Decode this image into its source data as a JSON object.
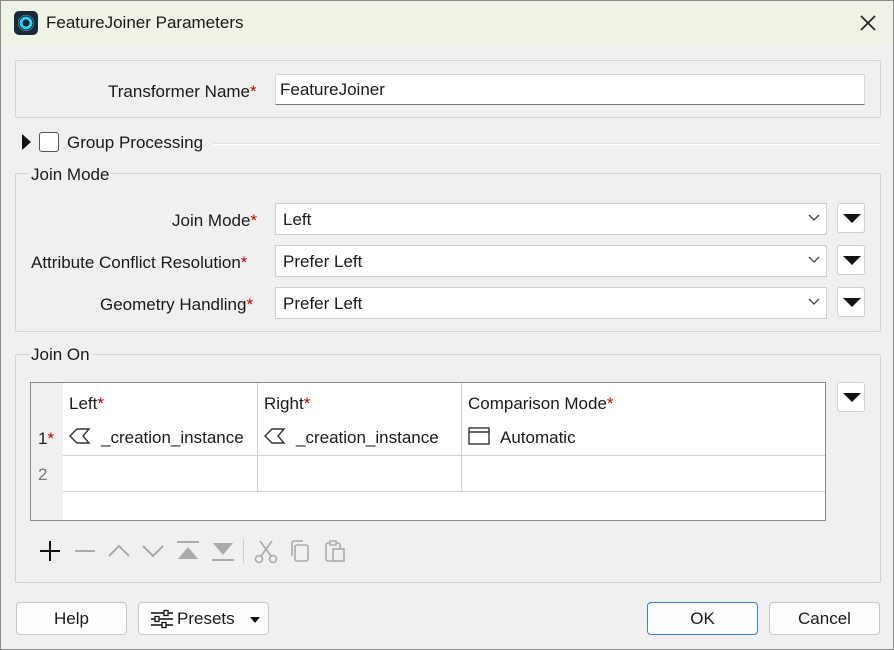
{
  "window": {
    "title": "FeatureJoiner Parameters",
    "close_glyph": "✕"
  },
  "transformer": {
    "label": "Transformer Name",
    "value": "FeatureJoiner"
  },
  "group_processing": {
    "label": "Group Processing",
    "checked": false
  },
  "join_mode_group": {
    "title": "Join Mode",
    "fields": [
      {
        "label": "Join Mode",
        "value": "Left"
      },
      {
        "label": "Attribute Conflict Resolution",
        "value": "Prefer Left"
      },
      {
        "label": "Geometry Handling",
        "value": "Prefer Left"
      }
    ]
  },
  "join_on_group": {
    "title": "Join On",
    "columns": [
      "Left",
      "Right",
      "Comparison Mode"
    ],
    "rows": [
      {
        "num": "1",
        "required": true,
        "left": "_creation_instance",
        "right": "_creation_instance",
        "mode": "Automatic"
      },
      {
        "num": "2",
        "required": false,
        "left": "",
        "right": "",
        "mode": ""
      }
    ]
  },
  "toolbar": {
    "icons": [
      "add-icon",
      "remove-icon",
      "move-up-icon",
      "move-down-icon",
      "move-top-icon",
      "move-bottom-icon",
      "cut-icon",
      "copy-icon",
      "paste-icon"
    ]
  },
  "footer": {
    "help": "Help",
    "presets": "Presets",
    "ok": "OK",
    "cancel": "Cancel"
  },
  "required_mark": "*",
  "colors": {
    "accent": "#3f7fc8",
    "required": "#c40000",
    "titlebar": "#eef3e6"
  }
}
